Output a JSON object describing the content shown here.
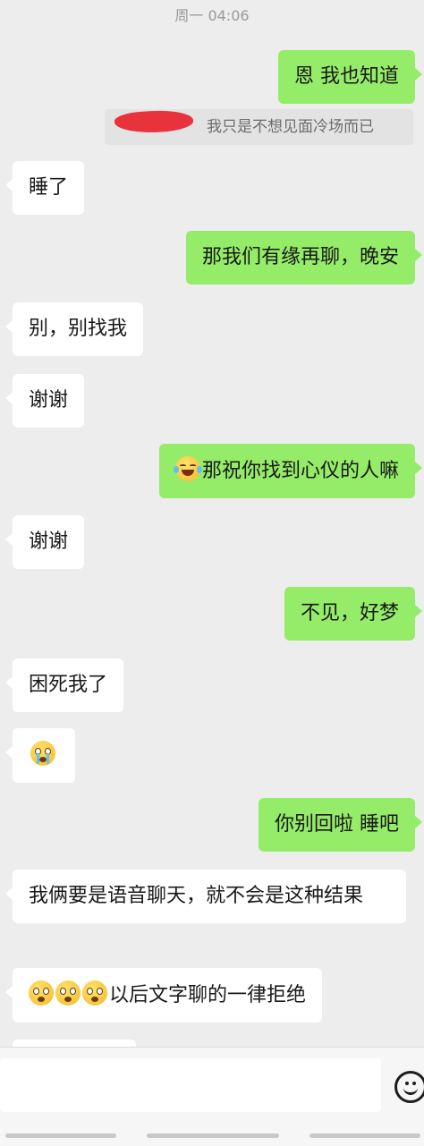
{
  "timestamp": "周一 04:06",
  "quote": {
    "sender": "",
    "text": "我只是不想见面冷场而已"
  },
  "messages": [
    {
      "side": "out",
      "text": "恩 我也知道"
    },
    {
      "side": "in",
      "text": "睡了"
    },
    {
      "side": "out",
      "text": "那我们有缘再聊，晚安"
    },
    {
      "side": "in",
      "text": "别，别找我"
    },
    {
      "side": "in",
      "text": "谢谢"
    },
    {
      "side": "out",
      "emoji": "laugh-cry-emoji",
      "text": "那祝你找到心仪的人嘛"
    },
    {
      "side": "in",
      "text": "谢谢"
    },
    {
      "side": "out",
      "text": "不见，好梦"
    },
    {
      "side": "in",
      "text": "困死我了"
    },
    {
      "side": "in",
      "emoji": "crying-emoji",
      "text": ""
    },
    {
      "side": "out",
      "text": "你别回啦 睡吧"
    },
    {
      "side": "in",
      "text": "我俩要是语音聊天，就不会是这种结果"
    },
    {
      "side": "in",
      "emoji": "flushed-emoji x3",
      "text": "以后文字聊的一律拒绝"
    }
  ],
  "input_bar": {
    "draft": "",
    "emoji_button_icon": "smiley-icon"
  },
  "colors": {
    "background": "#ededed",
    "incoming_bubble": "#ffffff",
    "outgoing_bubble": "#95ec69"
  }
}
